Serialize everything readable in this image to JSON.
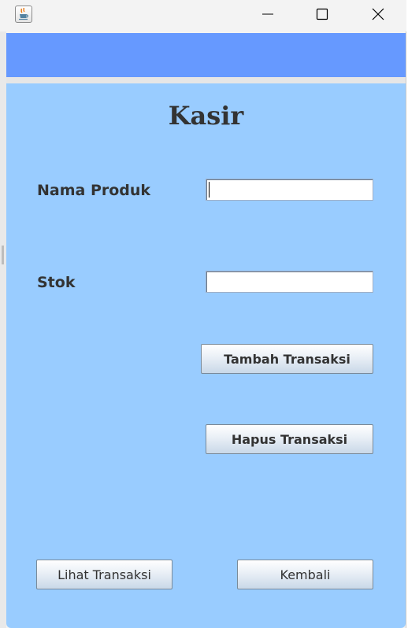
{
  "window": {
    "icon": "java-cup-icon",
    "controls": [
      "minimize-icon",
      "maximize-icon",
      "close-icon"
    ]
  },
  "colors": {
    "banner": "#6699ff",
    "content_background": "#99ccff",
    "text": "#333333"
  },
  "form": {
    "title": "Kasir",
    "nama_produk_label": "Nama Produk",
    "nama_produk_value": "",
    "stok_label": "Stok",
    "stok_value": ""
  },
  "buttons": {
    "tambah": "Tambah Transaksi",
    "hapus": "Hapus Transaksi",
    "lihat": "Lihat Transaksi",
    "kembali": "Kembali"
  }
}
